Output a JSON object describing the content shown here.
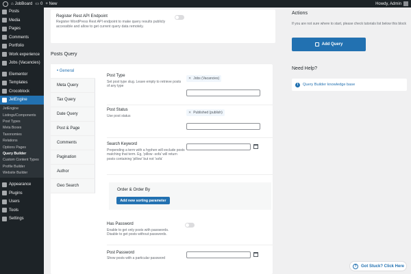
{
  "adminbar": {
    "site": "JobBoard",
    "comments_count": "0",
    "new_label": "+ New",
    "howdy": "Howdy, Admin"
  },
  "sidebar": {
    "items_top": [
      {
        "label": "Posts",
        "icon": "pin-icon"
      },
      {
        "label": "Media",
        "icon": "media-icon"
      },
      {
        "label": "Pages",
        "icon": "pages-icon"
      },
      {
        "label": "Comments",
        "icon": "comments-icon"
      },
      {
        "label": "Portfolio",
        "icon": "portfolio-icon"
      },
      {
        "label": "Work experience",
        "icon": "work-icon"
      },
      {
        "label": "Jobs (Vacancies)",
        "icon": "jobs-icon"
      }
    ],
    "items_mid": [
      {
        "label": "Elementor",
        "icon": "elementor-icon"
      },
      {
        "label": "Templates",
        "icon": "templates-icon"
      },
      {
        "label": "Crocoblock",
        "icon": "crocoblock-icon"
      }
    ],
    "active": {
      "label": "JetEngine",
      "icon": "jetengine-icon"
    },
    "submenu": [
      "JetEngine",
      "Listings/Components",
      "Post Types",
      "Meta Boxes",
      "Taxonomies",
      "Relations",
      "Options Pages",
      "Query Builder",
      "Custom Content Types",
      "Profile Builder",
      "Website Builder"
    ],
    "submenu_current": "Query Builder",
    "items_bottom": [
      {
        "label": "Appearance",
        "icon": "appearance-icon"
      },
      {
        "label": "Plugins",
        "icon": "plugins-icon"
      },
      {
        "label": "Users",
        "icon": "users-icon"
      },
      {
        "label": "Tools",
        "icon": "tools-icon"
      },
      {
        "label": "Settings",
        "icon": "settings-icon"
      }
    ]
  },
  "rest": {
    "title": "Register Rest API Endpoint",
    "desc": "Register WordPress Rest API endpoint to make query results publicly accessible and allow to get current query data remotely."
  },
  "posts_query": {
    "heading": "Posts Query",
    "tabs": [
      "• General",
      "Meta Query",
      "Tax Query",
      "Date Query",
      "Post & Page",
      "Comments",
      "Pagination",
      "Author",
      "Geo Search"
    ],
    "post_type": {
      "label": "Post Type",
      "help": "Set post type slug. Leave empty to retrieve posts of any type",
      "chip": "Jobs (Vacancies)"
    },
    "post_status": {
      "label": "Post Status",
      "help": "Use post status",
      "chip": "Published (publish)"
    },
    "search": {
      "label": "Search Keyword",
      "help": "Prepending a term with a hyphen will exclude posts matching that term. Eg, 'pillow -sofa' will return posts containing 'pillow' but not 'sofa'"
    },
    "order": {
      "label": "Order & Order By",
      "button": "Add new sorting parameter"
    },
    "has_password": {
      "label": "Has Password",
      "help": "Enable to get only posts with passwords. Disable to get posts without passwords."
    },
    "post_password": {
      "label": "Post Password",
      "help": "Show posts with a particular password"
    }
  },
  "actions": {
    "title": "Actions",
    "desc": "If you are not sure where to start, please check tutorials list below this block",
    "add_query": "Add Query"
  },
  "help": {
    "title": "Need Help?",
    "link": "Query Builder knowledge base"
  },
  "stuck": "Got Stuck? Click Here",
  "colors": {
    "accent": "#2271b1",
    "sidebar": "#1d2327"
  }
}
